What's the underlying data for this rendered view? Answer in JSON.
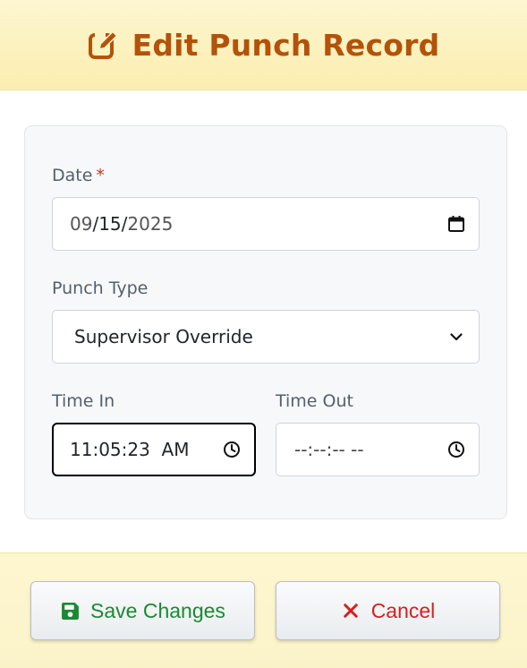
{
  "header": {
    "title": "Edit Punch Record",
    "icon": "edit-square-icon",
    "accent": "#b4520a"
  },
  "form": {
    "date": {
      "label": "Date",
      "required_mark": "*",
      "value_month": "09",
      "value_day": "15",
      "value_year": "2025",
      "sep": "/",
      "icon": "calendar-icon"
    },
    "punch_type": {
      "label": "Punch Type",
      "selected": "Supervisor Override",
      "icon": "chevron-down-icon"
    },
    "time_in": {
      "label": "Time In",
      "value": "11:05:23  AM",
      "icon": "clock-icon"
    },
    "time_out": {
      "label": "Time Out",
      "placeholder": "--:--:-- --",
      "icon": "clock-icon"
    }
  },
  "footer": {
    "save_label": "Save Changes",
    "save_icon": "floppy-disk-icon",
    "save_color": "#1a8a32",
    "cancel_label": "Cancel",
    "cancel_icon": "x-mark-icon",
    "cancel_color": "#d32020"
  }
}
